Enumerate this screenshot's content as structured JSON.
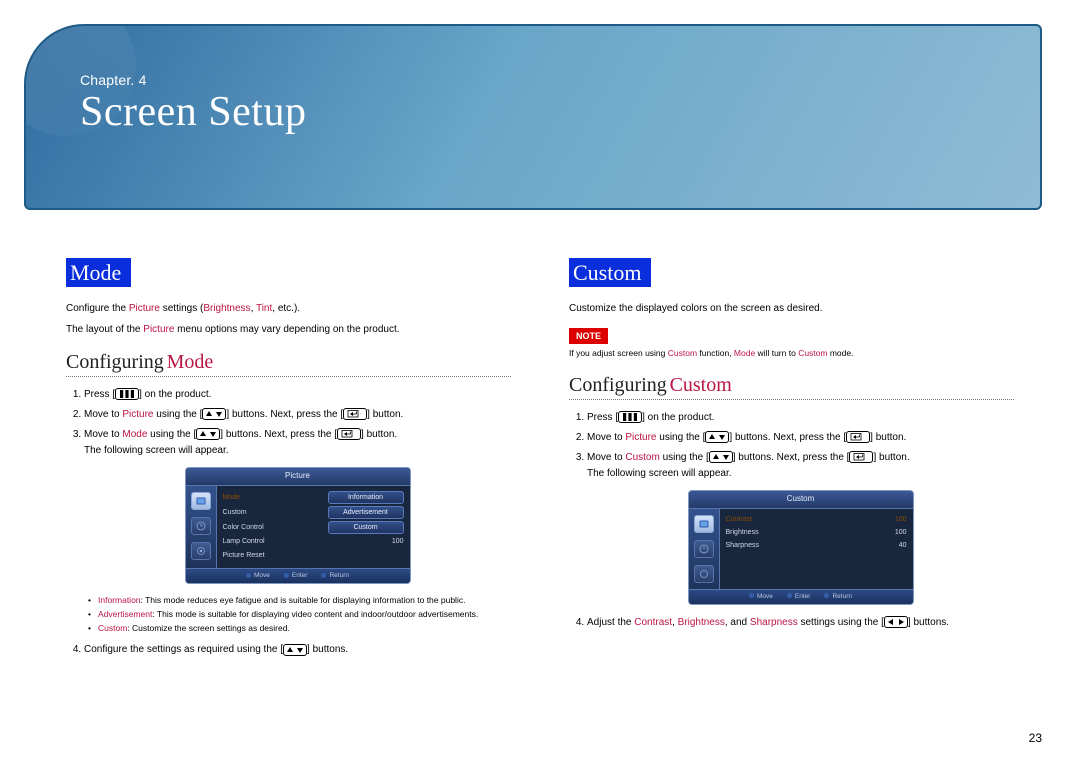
{
  "page_number": "23",
  "chapter": {
    "label": "Chapter. 4",
    "title": "Screen Setup"
  },
  "notes_label": "NOTE",
  "left": {
    "heading": "Mode",
    "intro1_pre": "Configure the ",
    "intro1_kw1": "Picture",
    "intro1_mid": " settings (",
    "intro1_kw2": "Brightness",
    "intro1_sep": ", ",
    "intro1_kw3": "Tint",
    "intro1_post": ", etc.).",
    "intro2_pre": "The layout of the ",
    "intro2_kw": "Picture",
    "intro2_post": " menu options may vary depending on the product.",
    "subhead_cfg": "Configuring",
    "subhead_topic": "Mode",
    "step1_pre": "Press [",
    "step1_post": "] on the product.",
    "step2_pre": "Move to ",
    "step2_kw": "Picture",
    "step2_mid": " using the [",
    "step2_mid2": "] buttons. Next, press the [",
    "step2_post": "] button.",
    "step3_pre": "Move to ",
    "step3_kw": "Mode",
    "step3_mid": " using the [",
    "step3_mid2": "] buttons. Next, press the [",
    "step3_post": "] button.",
    "step3_sub": "The following screen will appear.",
    "bul1_kw": "Information",
    "bul1_txt": ": This mode reduces eye fatigue and is suitable for displaying information to the public.",
    "bul2_kw": "Advertisement",
    "bul2_txt": ": This mode is suitable for displaying video content and indoor/outdoor advertisements.",
    "bul3_kw": "Custom",
    "bul3_txt": ": Customize the screen settings as desired.",
    "step4_pre": "Configure the settings as required using the [",
    "step4_post": "] buttons.",
    "osd": {
      "title": "Picture",
      "foot1": "Move",
      "foot2": "Enter",
      "foot3": "Return",
      "rows": [
        {
          "lbl": "Mode",
          "val": "Information"
        },
        {
          "lbl": "Custom",
          "val": "Advertisement"
        },
        {
          "lbl": "Color Control",
          "val": "Custom"
        },
        {
          "lbl": "Lamp Control",
          "valnum": "100"
        },
        {
          "lbl": "Picture Reset"
        }
      ]
    }
  },
  "right": {
    "heading": "Custom",
    "intro1": "Customize the displayed colors on the screen as desired.",
    "note_pre": "If you adjust screen using ",
    "note_kw1": "Custom",
    "note_mid1": " function, ",
    "note_kw2": "Mode",
    "note_mid2": " will turn to ",
    "note_kw3": "Custom",
    "note_post": " mode.",
    "subhead_cfg": "Configuring",
    "subhead_topic": "Custom",
    "step1_pre": "Press [",
    "step1_post": "] on the product.",
    "step2_pre": "Move to ",
    "step2_kw": "Picture",
    "step2_mid": " using the [",
    "step2_mid2": "] buttons. Next, press the [",
    "step2_post": "] button.",
    "step3_pre": "Move to ",
    "step3_kw": "Custom",
    "step3_mid": " using the [",
    "step3_mid2": "] buttons. Next, press the [",
    "step3_post": "] button.",
    "step3_sub": "The following screen will appear.",
    "step4_pre": "Adjust the ",
    "step4_kw1": "Contrast",
    "step4_sep1": ", ",
    "step4_kw2": "Brightness",
    "step4_sep2": ", and ",
    "step4_kw3": "Sharpness",
    "step4_mid": " settings using the [",
    "step4_post": "] buttons.",
    "osd": {
      "title": "Custom",
      "foot1": "Move",
      "foot2": "Enter",
      "foot3": "Return",
      "rows": [
        {
          "lbl": "Contrast",
          "valnum": "100"
        },
        {
          "lbl": "Brightness",
          "valnum": "100"
        },
        {
          "lbl": "Sharpness",
          "valnum": "40"
        }
      ]
    }
  }
}
